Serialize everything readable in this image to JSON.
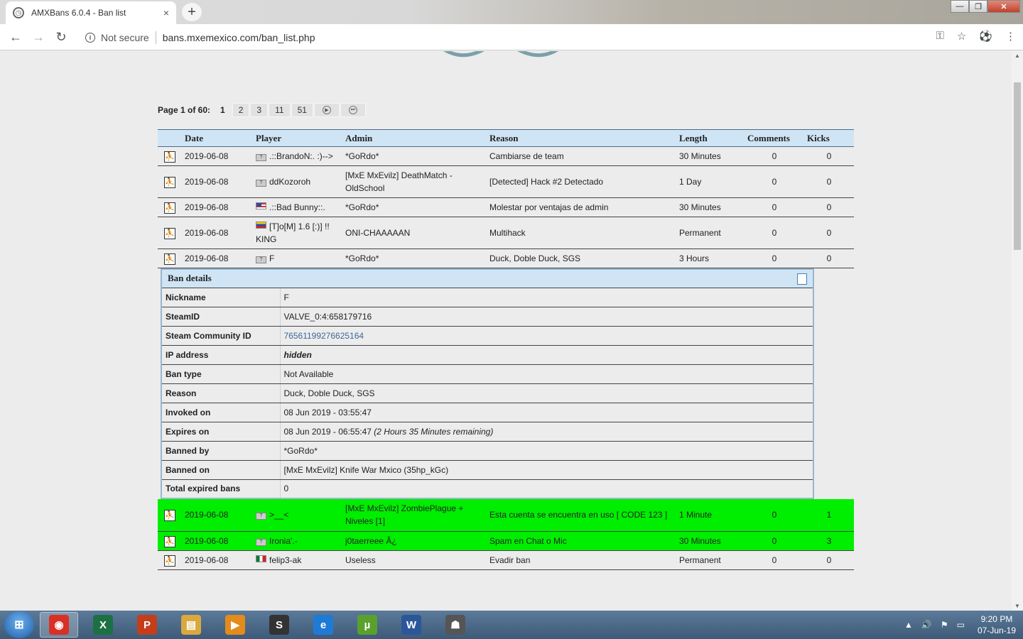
{
  "browser": {
    "tab_title": "AMXBans 6.0.4 - Ban list",
    "tab_close": "×",
    "new_tab": "+",
    "security": "Not secure",
    "url": "bans.mxemexico.com/ban_list.php",
    "back": "←",
    "forward": "→",
    "reload": "↻",
    "info": "i",
    "key": "⚿",
    "star": "☆",
    "ext": "⚽",
    "menu": "⋮",
    "min": "—",
    "max": "❐",
    "close": "✕"
  },
  "pager": {
    "label": "Page 1 of 60:",
    "current": "1",
    "pages": [
      "2",
      "3",
      "11",
      "51"
    ],
    "next_icon": "next-page-icon",
    "last_icon": "last-page-icon",
    "next": "▶",
    "last": "⏭"
  },
  "table": {
    "headers": [
      "Date",
      "Player",
      "Admin",
      "Reason",
      "Length",
      "Comments",
      "Kicks"
    ],
    "rows": [
      {
        "date": "2019-06-08",
        "flag": "unknown",
        "player": ".::BrandoN:. :)-->",
        "admin": "*GoRdo*",
        "reason": "Cambiarse de team",
        "length": "30 Minutes",
        "comments": "0",
        "kicks": "0"
      },
      {
        "date": "2019-06-08",
        "flag": "unknown",
        "player": "ddKozoroh",
        "admin": "[MxE MxEvilz] DeathMatch - OldSchool",
        "reason": "[Detected] Hack #2 Detectado",
        "length": "1 Day",
        "comments": "0",
        "kicks": "0"
      },
      {
        "date": "2019-06-08",
        "flag": "us",
        "player": ".::Bad Bunny::.",
        "admin": "*GoRdo*",
        "reason": "Molestar por ventajas de admin",
        "length": "30 Minutes",
        "comments": "0",
        "kicks": "0"
      },
      {
        "date": "2019-06-08",
        "flag": "ve",
        "player": "[T]o[M] 1.6 [:)] !! KING",
        "admin": "ONI-CHAAAAAN",
        "reason": "Multihack",
        "length": "Permanent",
        "comments": "0",
        "kicks": "0"
      },
      {
        "date": "2019-06-08",
        "flag": "unknown",
        "player": "F",
        "admin": "*GoRdo*",
        "reason": "Duck, Doble Duck, SGS",
        "length": "3 Hours",
        "comments": "0",
        "kicks": "0"
      }
    ],
    "rows_after": [
      {
        "date": "2019-06-08",
        "flag": "unknown",
        "player": ">__<",
        "admin": "[MxE MxEvilz] ZombiePlague + Niveles [1]",
        "reason": "Esta cuenta se encuentra en uso [ CODE 123 ]",
        "length": "1 Minute",
        "comments": "0",
        "kicks": "1"
      },
      {
        "date": "2019-06-08",
        "flag": "unknown",
        "player": "Ironia'.-",
        "admin": "j0taerreee Â¿",
        "reason": "Spam en Chat o Mic",
        "length": "30 Minutes",
        "comments": "0",
        "kicks": "3"
      },
      {
        "date": "2019-06-08",
        "flag": "mx",
        "player": "felip3-ak",
        "admin": "Useless",
        "reason": "Evadir ban",
        "length": "Permanent",
        "comments": "0",
        "kicks": "0"
      }
    ]
  },
  "details": {
    "title": "Ban details",
    "nickname_label": "Nickname",
    "nickname": "F",
    "steamid_label": "SteamID",
    "steamid": "VALVE_0:4:658179716",
    "community_label": "Steam Community ID",
    "community": "76561199276625164",
    "ip_label": "IP address",
    "ip": "hidden",
    "bantype_label": "Ban type",
    "bantype": "Not Available",
    "reason_label": "Reason",
    "reason": "Duck, Doble Duck, SGS",
    "invoked_label": "Invoked on",
    "invoked": "08 Jun 2019 - 03:55:47",
    "expires_label": "Expires on",
    "expires": "08 Jun 2019 - 06:55:47",
    "remaining": "(2 Hours 35 Minutes remaining)",
    "bannedby_label": "Banned by",
    "bannedby": "*GoRdo*",
    "bannedon_label": "Banned on",
    "bannedon": "[MxE MxEvilz] Knife War Mxico (35hp_kGc)",
    "expired_label": "Total expired bans",
    "expired": "0"
  },
  "colors": {
    "header_bg": "#cfe5f5",
    "highlight": "#00ee00",
    "link": "#3a6a9a"
  },
  "taskbar": {
    "start": "⊞",
    "apps": [
      {
        "name": "chrome",
        "glyph": "◉",
        "color": "#d93025"
      },
      {
        "name": "excel",
        "glyph": "X",
        "color": "#1d7044"
      },
      {
        "name": "powerpoint",
        "glyph": "P",
        "color": "#c43e1c"
      },
      {
        "name": "explorer",
        "glyph": "▤",
        "color": "#d9a840"
      },
      {
        "name": "media",
        "glyph": "▶",
        "color": "#e38b1b"
      },
      {
        "name": "app-s",
        "glyph": "S",
        "color": "#333333"
      },
      {
        "name": "ie",
        "glyph": "e",
        "color": "#1f7ad6"
      },
      {
        "name": "utorrent",
        "glyph": "µ",
        "color": "#5aa02c"
      },
      {
        "name": "word",
        "glyph": "W",
        "color": "#2b579a"
      },
      {
        "name": "cs16",
        "glyph": "☗",
        "color": "#555555"
      }
    ],
    "tray_up": "▲",
    "volume": "🔊",
    "flag": "⚑",
    "network": "▭",
    "time": "9:20 PM",
    "date": "07-Jun-19"
  }
}
